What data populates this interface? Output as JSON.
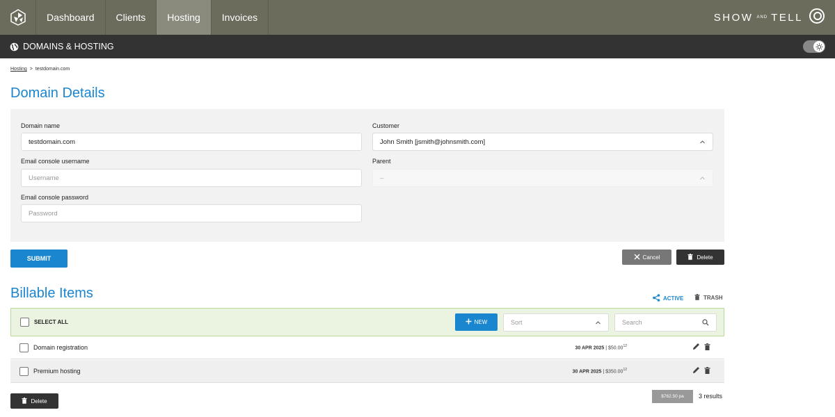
{
  "nav": {
    "items": [
      {
        "label": "Dashboard",
        "active": false
      },
      {
        "label": "Clients",
        "active": false
      },
      {
        "label": "Hosting",
        "active": true
      },
      {
        "label": "Invoices",
        "active": false
      }
    ],
    "brand": {
      "left": "SHOW",
      "middle": "AND",
      "right": "TELL"
    }
  },
  "section_bar": {
    "icon": "globe-icon",
    "title": "DOMAINS & HOSTING"
  },
  "breadcrumb": {
    "parent": "Hosting",
    "separator": ">",
    "current": "testdomain.com"
  },
  "page_title": "Domain Details",
  "form": {
    "domain_name": {
      "label": "Domain name",
      "value": "testdomain.com"
    },
    "email_username": {
      "label": "Email console username",
      "placeholder": "Username"
    },
    "email_password": {
      "label": "Email console password",
      "placeholder": "Password"
    },
    "customer": {
      "label": "Customer",
      "value": "John Smith [jsmith@johnsmith.com]"
    },
    "parent": {
      "label": "Parent",
      "value": "–"
    }
  },
  "buttons": {
    "submit": "SUBMIT",
    "cancel": "Cancel",
    "delete": "Delete"
  },
  "billable": {
    "title": "Billable Items",
    "filters": {
      "active": "ACTIVE",
      "trash": "TRASH"
    },
    "select_all": "SELECT ALL",
    "new": "NEW",
    "sort_placeholder": "Sort",
    "search_placeholder": "Search",
    "rows": [
      {
        "name": "Domain registration",
        "date": "30 APR 2025",
        "price": "$50.00",
        "period": "12"
      },
      {
        "name": "Premium hosting",
        "date": "30 APR 2025",
        "price": "$350.00",
        "period": "12"
      }
    ],
    "delete": "Delete",
    "total": "$762.50 pa",
    "results": "3 results"
  },
  "colors": {
    "accent": "#1a86cf",
    "topbar": "#6b6c5c",
    "subbar": "#333333",
    "toolbar_bg": "#eaf4e0"
  }
}
